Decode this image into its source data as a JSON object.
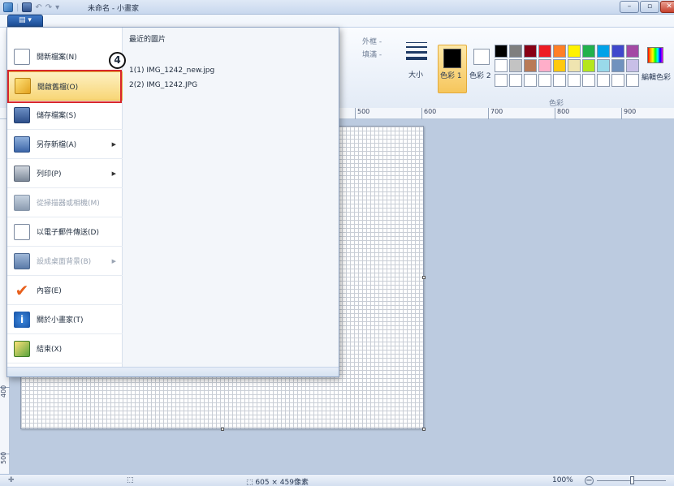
{
  "window": {
    "title": "未命名 - 小畫家",
    "min": "–",
    "max": "▫",
    "close": "✕"
  },
  "ribbon": {
    "file_tab": "▤ ▾",
    "outline": "外框 -",
    "fill": "填滿 -",
    "size": "大小",
    "color1": "色彩 1",
    "color2": "色彩 2",
    "colors_group": "色彩",
    "edit_colors": "編輯色彩"
  },
  "palette": [
    "#000000",
    "#7f7f7f",
    "#880015",
    "#ed1c24",
    "#ff7f27",
    "#fff200",
    "#22b14c",
    "#00a2e8",
    "#3f48cc",
    "#a349a4",
    "#ffffff",
    "#c3c3c3",
    "#b97a57",
    "#ffaec9",
    "#ffc90e",
    "#efe4b0",
    "#b5e61d",
    "#99d9ea",
    "#7092be",
    "#c8bfe7",
    "#ffffff",
    "#ffffff",
    "#ffffff",
    "#ffffff",
    "#ffffff",
    "#ffffff",
    "#ffffff",
    "#ffffff",
    "#ffffff",
    "#ffffff"
  ],
  "ruler": {
    "ticks": [
      "500",
      "600",
      "700",
      "800",
      "900"
    ],
    "vticks": [
      "400",
      "500"
    ]
  },
  "file_menu": {
    "items": [
      {
        "label": "開新檔案(N)",
        "disabled": false,
        "arrow": false
      },
      {
        "label": "開啟舊檔(O)",
        "disabled": false,
        "arrow": false
      },
      {
        "label": "儲存檔案(S)",
        "disabled": false,
        "arrow": false
      },
      {
        "label": "另存新檔(A)",
        "disabled": false,
        "arrow": true
      },
      {
        "label": "列印(P)",
        "disabled": false,
        "arrow": true
      },
      {
        "label": "從掃描器或相機(M)",
        "disabled": true,
        "arrow": false
      },
      {
        "label": "以電子郵件傳送(D)",
        "disabled": false,
        "arrow": false
      },
      {
        "label": "設成桌面背景(B)",
        "disabled": true,
        "arrow": true
      },
      {
        "label": "內容(E)",
        "disabled": false,
        "arrow": false
      },
      {
        "label": "關於小畫家(T)",
        "disabled": false,
        "arrow": false
      },
      {
        "label": "結束(X)",
        "disabled": false,
        "arrow": false
      }
    ],
    "arrow_glyph": "▶",
    "recent_title": "最近的圖片",
    "recent": [
      "1(1) IMG_1242_new.jpg",
      "2(2) IMG_1242.JPG"
    ]
  },
  "annotation": {
    "step": "4"
  },
  "status": {
    "cursor": "✛",
    "selection": "⬚",
    "size": "⬚ 605 × 459像素",
    "zoom": "100%",
    "zoom_minus": "−"
  }
}
